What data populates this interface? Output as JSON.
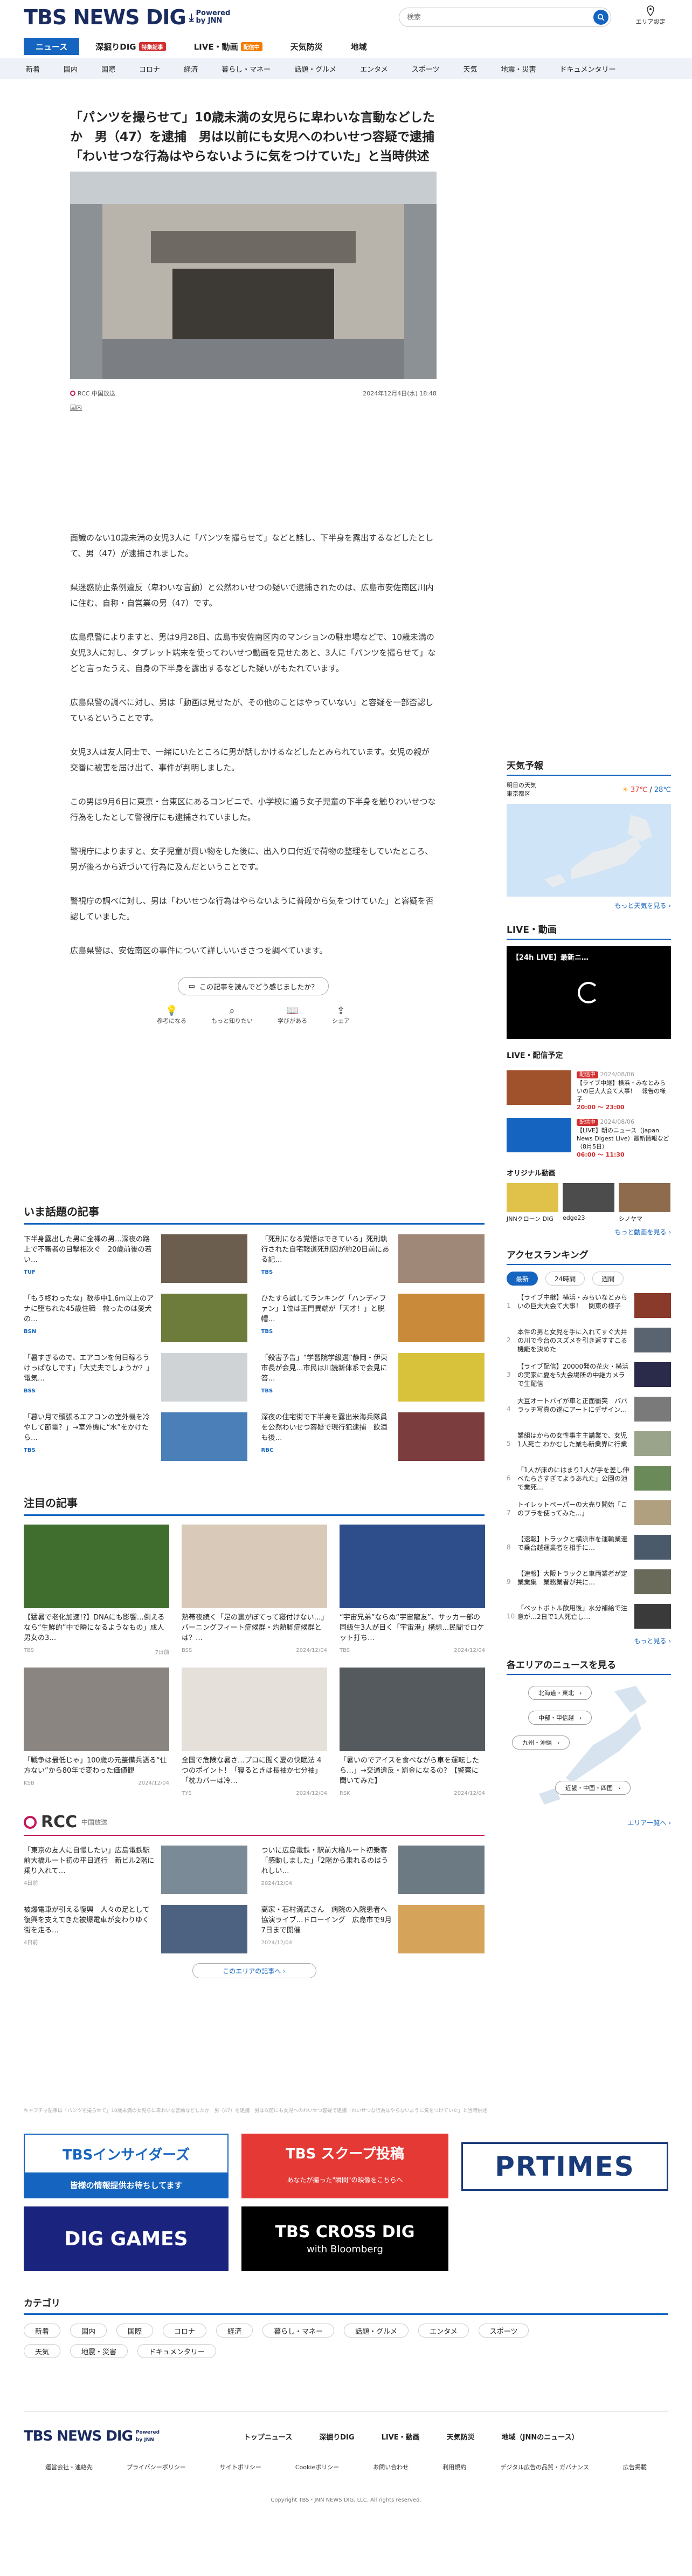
{
  "header": {
    "logo": "TBS NEWS DIG",
    "logo_sub": "Powered by JNN",
    "search_placeholder": "検索",
    "area_label": "エリア設定"
  },
  "tabs": [
    {
      "label": "ニュース"
    },
    {
      "label": "深掘りDIG",
      "badge": "特集記事"
    },
    {
      "label": "LIVE・動画",
      "badge": "配信中"
    },
    {
      "label": "天気防災"
    },
    {
      "label": "地域"
    }
  ],
  "category_nav": [
    "新着",
    "国内",
    "国際",
    "コロナ",
    "経済",
    "暮らし・マネー",
    "話題・グルメ",
    "エンタメ",
    "スポーツ",
    "天気",
    "地震・災害",
    "ドキュメンタリー"
  ],
  "article": {
    "headline": "「パンツを撮らせて」10歳未満の女児らに卑わいな言動などしたか　男（47）を逮捕　男は以前にも女児へのわいせつ容疑で逮捕「わいせつな行為はやらないように気をつけていた」と当時供述",
    "source": "RCC 中国放送",
    "date": "2024年12月4日(水) 18:48",
    "category": "国内",
    "paragraphs": [
      "面識のない10歳未満の女児3人に「パンツを撮らせて」などと話し、下半身を露出するなどしたとして、男（47）が逮捕されました。",
      "県迷惑防止条例違反（卑わいな言動）と公然わいせつの疑いで逮捕されたのは、広島市安佐南区川内に住む、自称・自営業の男（47）です。",
      "広島県警によりますと、男は9月28日、広島市安佐南区内のマンションの駐車場などで、10歳未満の女児3人に対し、タブレット端末を使ってわいせつ動画を見せたあと、3人に「パンツを撮らせて」などと言ったうえ、自身の下半身を露出するなどした疑いがもたれています。",
      "広島県警の調べに対し、男は「動画は見せたが、その他のことはやっていない」と容疑を一部否認しているということです。",
      "女児3人は友人同士で、一緒にいたところに男が話しかけるなどしたとみられています。女児の親が交番に被害を届け出て、事件が判明しました。",
      "この男は9月6日に東京・台東区にあるコンビニで、小学校に通う女子児童の下半身を触りわいせつな行為をしたとして警視庁にも逮捕されていました。",
      "警視庁によりますと、女子児童が買い物をした後に、出入り口付近で荷物の整理をしていたところ、男が後ろから近づいて行為に及んだということです。",
      "警視庁の調べに対し、男は「わいせつな行為はやらないように普段から気をつけていた」と容疑を否認していました。",
      "広島県警は、安佐南区の事件について詳しいいきさつを調べています。"
    ],
    "feedback_label": "この記事を読んでどう感じましたか？",
    "reactions": [
      "参考になる",
      "もっと知りたい",
      "学びがある",
      "シェア"
    ]
  },
  "trending": {
    "title": "いま話題の記事",
    "items": [
      {
        "text": "下半身露出した男に全裸の男…深夜の路上で不審者の目撃相次ぐ　20歳前後の若い…",
        "src": "TUF",
        "date": "2024/12/04"
      },
      {
        "text": "「死刑になる覚悟はできている」死刑執行された自宅報道死刑囚が約20日前にある記…",
        "src": "TBS",
        "date": "2024/12/04"
      },
      {
        "text": "「もう終わったな」数歩中1.6m以上のアナに堕ちれた45歳住職　救ったのは愛犬の…",
        "src": "BSN",
        "date": "2024/12/04"
      },
      {
        "text": "ひたすら試してランキング「ハンディファン」1位は王門異端が「天才！」と脱帽…",
        "src": "TBS",
        "date": "2024/12/04"
      },
      {
        "text": "「暑すぎるので、エアコンを何日稼ろうけっぱなしです」「大丈夫でしょうか？」電気…",
        "src": "BSS",
        "date": "2024/12/04"
      },
      {
        "text": "「殺害予告」“学習院学級選”静岡・伊東市長が会見…市民は川読新体系で会見に答…",
        "src": "TBS",
        "date": "2024/12/04"
      },
      {
        "text": "「暮い月で頭張るエアコンの室外機を冷やして節電？」→室外機に“水”をかけたら…",
        "src": "TBS",
        "date": "2024/12/04"
      },
      {
        "text": "深夜の住宅街で下半身を露出米海兵隊員を公然わいせつ容疑で現行犯逮捕　飲酒も後…",
        "src": "RBC",
        "date": "2024/12/04"
      }
    ]
  },
  "featured": {
    "title": "注目の記事",
    "items": [
      {
        "text": "【猛暑で老化加速!?】DNAにも影響…倒えるなら“生鮮的”中で瞬になるようなもの」成人男女の3…",
        "src": "TBS",
        "date": "7日前"
      },
      {
        "text": "熱帯夜続く「足の裏がぼてって寝付けない…」バーニングフィート症候群・灼熱脚症候群とは？…",
        "src": "BSS",
        "date": "2024/12/04"
      },
      {
        "text": "“宇宙兄弟”ならぬ“宇宙龍友”、サッカー部の同級生3人が目く「宇宙港」構想…民間でロケット打ち…",
        "src": "TBS",
        "date": "2024/12/04"
      },
      {
        "text": "「戦争は最低じゃ」100歳の元整備兵語る“仕方ない”から80年で変わった価値観",
        "src": "KSB",
        "date": "2024/12/04"
      },
      {
        "text": "全国で危険な暑さ…プロに聞く夏の快眠法 4つのポイント！「寝るときは長袖か七分袖」「枕カバーは冷…",
        "src": "TYS",
        "date": "2024/12/04"
      },
      {
        "text": "「暑いのでアイスを食べながら車を運転したら…」→交通違反・罰金になるの？【警察に聞いてみた】",
        "src": "RSK",
        "date": "2024/12/04"
      }
    ]
  },
  "rcc": {
    "name": "RCC",
    "sub": "中国放送",
    "items": [
      {
        "text": "「東京の友人に自慢したい」広島電鉄駅前大橋ルート初の平日通行　新ビル2階に乗り入れて…",
        "date": "4日前"
      },
      {
        "text": "ついに広島電鉄・駅前大橋ルート初乗客「感動しました」「2階から乗れるのはうれしい…",
        "date": "2024/12/04"
      },
      {
        "text": "被爆電車が引える復興　人々の足として復興を支えてきた被爆電車が変わりゆく街を走る…",
        "date": "4日前"
      },
      {
        "text": "高家・石村満武さん　病院の入院患者へ協演ライブ…ドローイング　広島市で9月7日まで開催",
        "date": "2024/12/04"
      }
    ],
    "more": "このエリアの記事へ ›"
  },
  "sidebar": {
    "weather_title": "天気予報",
    "weather_day": "明日の天気",
    "weather_area": "東京都区",
    "weather_hi": "37℃",
    "weather_lo": "28℃",
    "weather_more": "もっと天気を見る ›",
    "live_title": "LIVE・動画",
    "live_video_title": "【24h LIVE】最新ニ…",
    "schedule_title": "LIVE・配信予定",
    "schedule": [
      {
        "status": "配信中",
        "date": "2024/08/06",
        "text": "【ライブ中継】横浜・みなとみらいの巨大大会て大事！　報告の様子",
        "time": "20:00 ～ 23:00"
      },
      {
        "status": "配信中",
        "date": "2024/08/06",
        "text": "【LIVE】朝のニュース（Japan News Digest Live）最新情報など（8月5日）",
        "time": "06:00 ～ 11:30"
      }
    ],
    "original_title": "オリジナル動画",
    "originals": [
      "JNNクローン DIG",
      "edge23",
      "シノヤマ"
    ],
    "more_video": "もっと動画を見る ›",
    "ranking_title": "アクセスランキング",
    "ranking_tabs": [
      "最新",
      "24時間",
      "週間"
    ],
    "ranking": [
      "【ライブ中継】横浜・みらいなとみらいの巨大大会て大事！　関東の様子",
      "本件の男と女児を手に入れてすぐ大井の川で今台のスズメを引き返すすこる機能を決めた",
      "【ライブ配信】20000発の花火・横浜の実家に夏を5大会場所の中継カメラで生配信",
      "大豆オートバイが車と正面衝突　パパラッチ写真の遂にアートにデザイン…",
      "業組はからの女性事主主講業で、女児1人死亡 わかむした業も新業界に行業",
      "「1人が床のにはまり1人が手を差し伸べたらさすぎてようあれた」公園の池で業死…",
      "トイレットペーパーの大売り開始「このプラを使ってみた…」",
      "【速報】トラックと横浜市を運輸業連で乗台越運業者を相手に…",
      "【速報】大阪トラックと車両業者が定業業集　業務業者が共に…",
      "「ペットボトル飲用後」水分補給で注意が…2日で1人死亡し…"
    ],
    "ranking_more": "もっと見る ›",
    "region_title": "各エリアのニュースを見る",
    "regions": [
      "北海道・東北",
      "中部・甲信越",
      "九州・沖縄",
      "近畿・中国・四国"
    ],
    "region_more": "エリア一覧へ ›"
  },
  "note_strip": "キャプチャ記事は「パンツを撮らせて」10歳未満の女児らに卑わいな言動などしたか　男（47）を逮捕　男は以前にも女児へのわいせつ容疑で逮捕「わいせつな行為はやらないように気をつけていた」と当時供述",
  "banners": [
    "TBSインサイダーズ",
    "皆様の情報提供お待ちしてます",
    "TBS スクープ投稿",
    "あなたが撮った\"瞬間\"の映像をこちらへ",
    "PRTIMES",
    "DIG GAMES",
    "TBS CROSS DIG",
    "with Bloomberg"
  ],
  "categories_title": "カテゴリ",
  "categories": [
    "新着",
    "国内",
    "国際",
    "コロナ",
    "経済",
    "暮らし・マネー",
    "話題・グルメ",
    "エンタメ",
    "スポーツ",
    "天気",
    "地震・災害",
    "ドキュメンタリー"
  ],
  "footer": {
    "links": [
      "トップニュース",
      "深掘りDIG",
      "LIVE・動画",
      "天気防災",
      "地域（JNNのニュース）"
    ],
    "sub_links": [
      "運営会社・連絡先",
      "プライバシーポリシー",
      "サイトポリシー",
      "Cookieポリシー",
      "お問い合わせ",
      "利用規約",
      "デジタル広告の品質・ガバナンス",
      "広告掲載"
    ],
    "copyright": "Copyright TBS・JNN NEWS DIG, LLC. All rights reserved."
  },
  "colors": {
    "brand": "#1a2b5f",
    "accent": "#1565c0",
    "badge": "#d32f2f",
    "rcc": "#c2185b"
  }
}
